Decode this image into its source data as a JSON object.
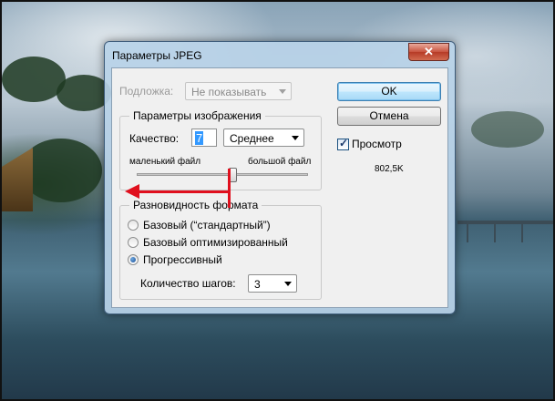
{
  "window": {
    "title": "Параметры JPEG",
    "close_glyph": "✕"
  },
  "matte": {
    "label": "Подложка:",
    "value": "Не показывать"
  },
  "image_options": {
    "title": "Параметры изображения",
    "quality_label": "Качество:",
    "quality_value": "7",
    "quality_preset": "Среднее",
    "small_file_label": "маленький файл",
    "large_file_label": "большой файл",
    "slider_fraction": 0.56
  },
  "format_options": {
    "title": "Разновидность формата",
    "options": [
      {
        "label": "Базовый (“стандартный”)",
        "checked": false
      },
      {
        "label": "Базовый оптимизированный",
        "checked": false
      },
      {
        "label": "Прогрессивный",
        "checked": true
      }
    ],
    "scans_label": "Количество шагов:",
    "scans_value": "3"
  },
  "buttons": {
    "ok": "OK",
    "cancel": "Отмена"
  },
  "preview": {
    "label": "Просмотр",
    "checked": true,
    "file_size": "802,5K"
  },
  "annotation_color": "#e0101e"
}
